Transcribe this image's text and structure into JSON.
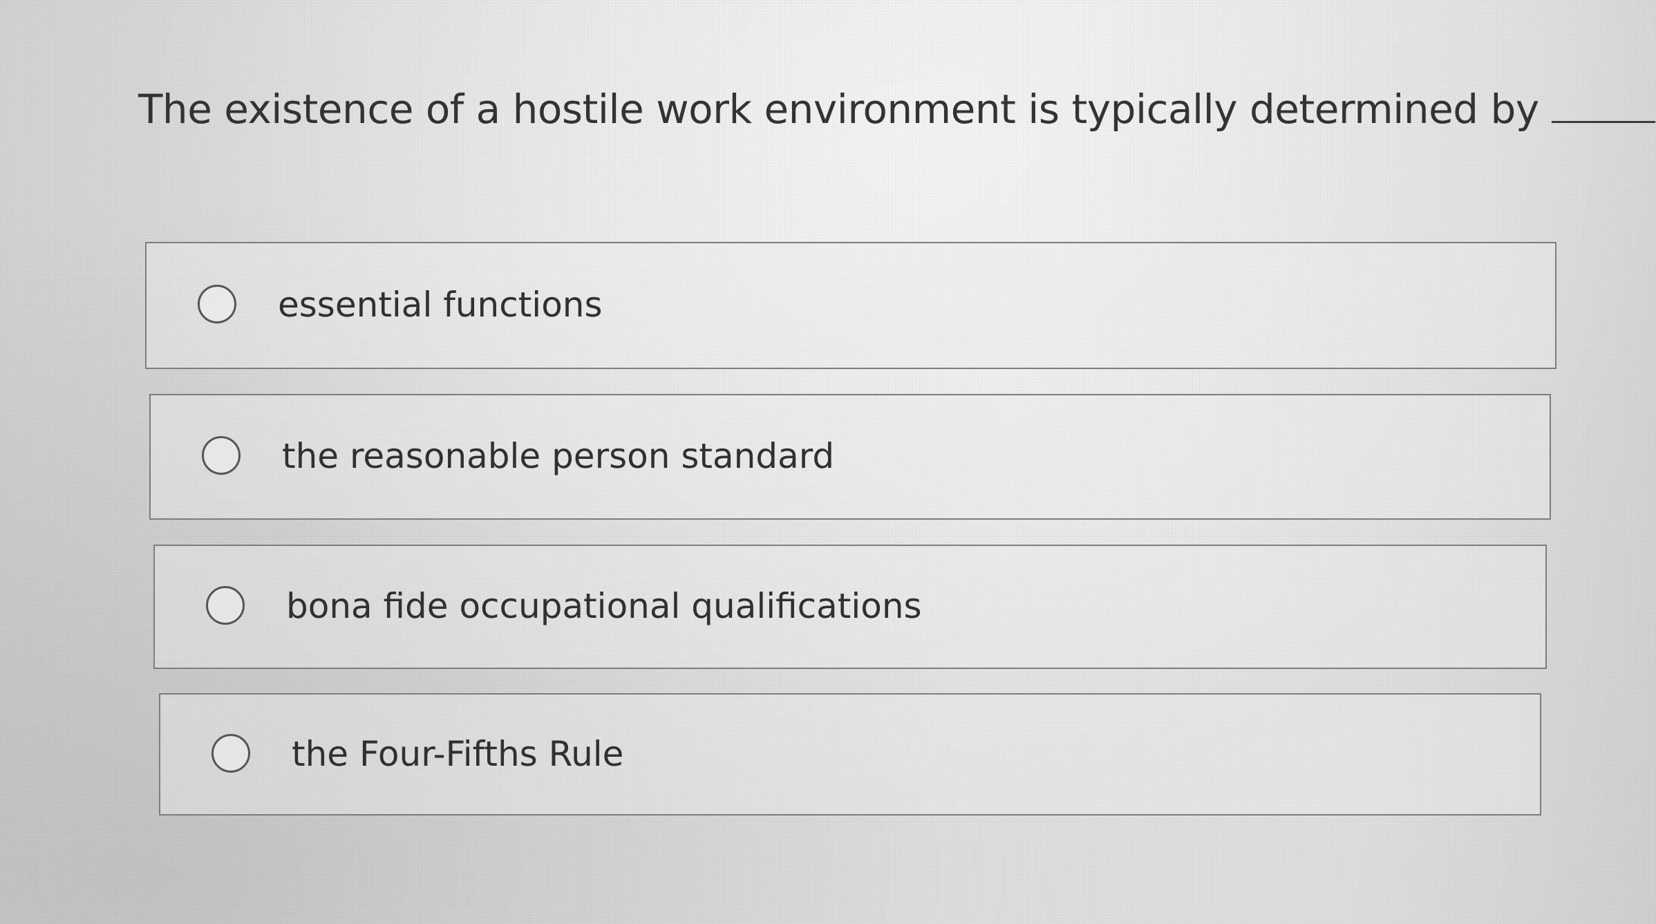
{
  "question": {
    "text": "The existence of a hostile work environment is typically determined by",
    "suffix": "."
  },
  "options": [
    {
      "label": "essential functions",
      "selected": false
    },
    {
      "label": "the reasonable person standard",
      "selected": false
    },
    {
      "label": "bona fide occupational qualifications",
      "selected": false
    },
    {
      "label": "the Four-Fifths Rule",
      "selected": false
    }
  ]
}
